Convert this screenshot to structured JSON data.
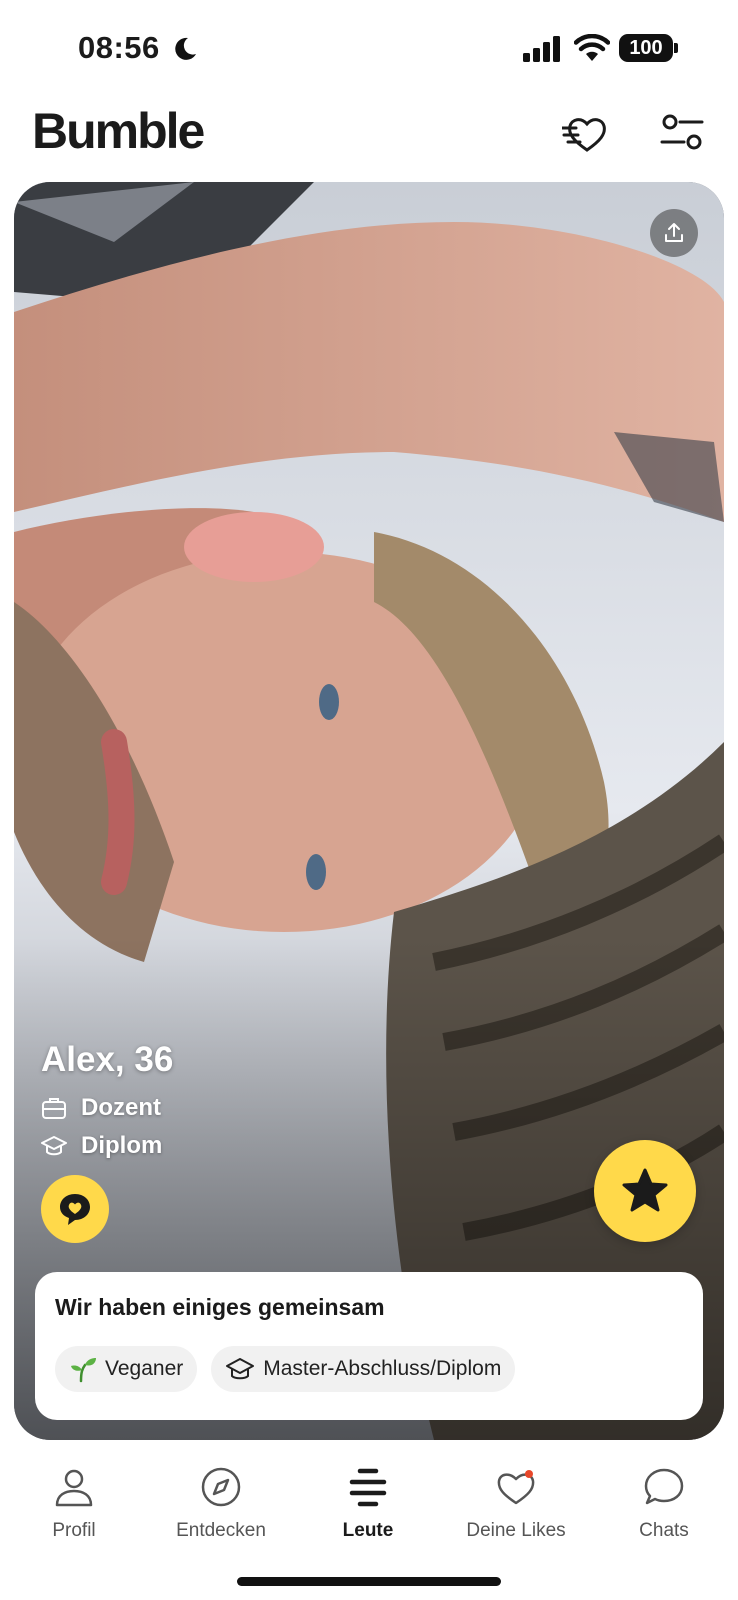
{
  "status_bar": {
    "time": "08:56",
    "battery": "100"
  },
  "header": {
    "logo": "Bumble",
    "icons": [
      "heart-speed-icon",
      "filter-sliders-icon"
    ]
  },
  "profile": {
    "name_age": "Alex, 36",
    "job": "Dozent",
    "education": "Diplom",
    "photo_subject": "man-lying-in-bed-with-cat"
  },
  "common": {
    "title": "Wir haben einiges gemeinsam",
    "chips": [
      {
        "label": "Veganer",
        "icon": "sprout-icon"
      },
      {
        "label": "Master-Abschluss/Diplom",
        "icon": "graduation-cap-icon"
      }
    ]
  },
  "nav": {
    "items": [
      {
        "label": "Profil",
        "icon": "person-icon"
      },
      {
        "label": "Entdecken",
        "icon": "compass-icon"
      },
      {
        "label": "Leute",
        "icon": "people-stack-icon",
        "active": true
      },
      {
        "label": "Deine Likes",
        "icon": "heart-icon",
        "badge": true
      },
      {
        "label": "Chats",
        "icon": "chat-bubble-icon"
      }
    ]
  },
  "colors": {
    "accent": "#ffd94a",
    "notification": "#e8472a",
    "text": "#1b1b1b"
  }
}
